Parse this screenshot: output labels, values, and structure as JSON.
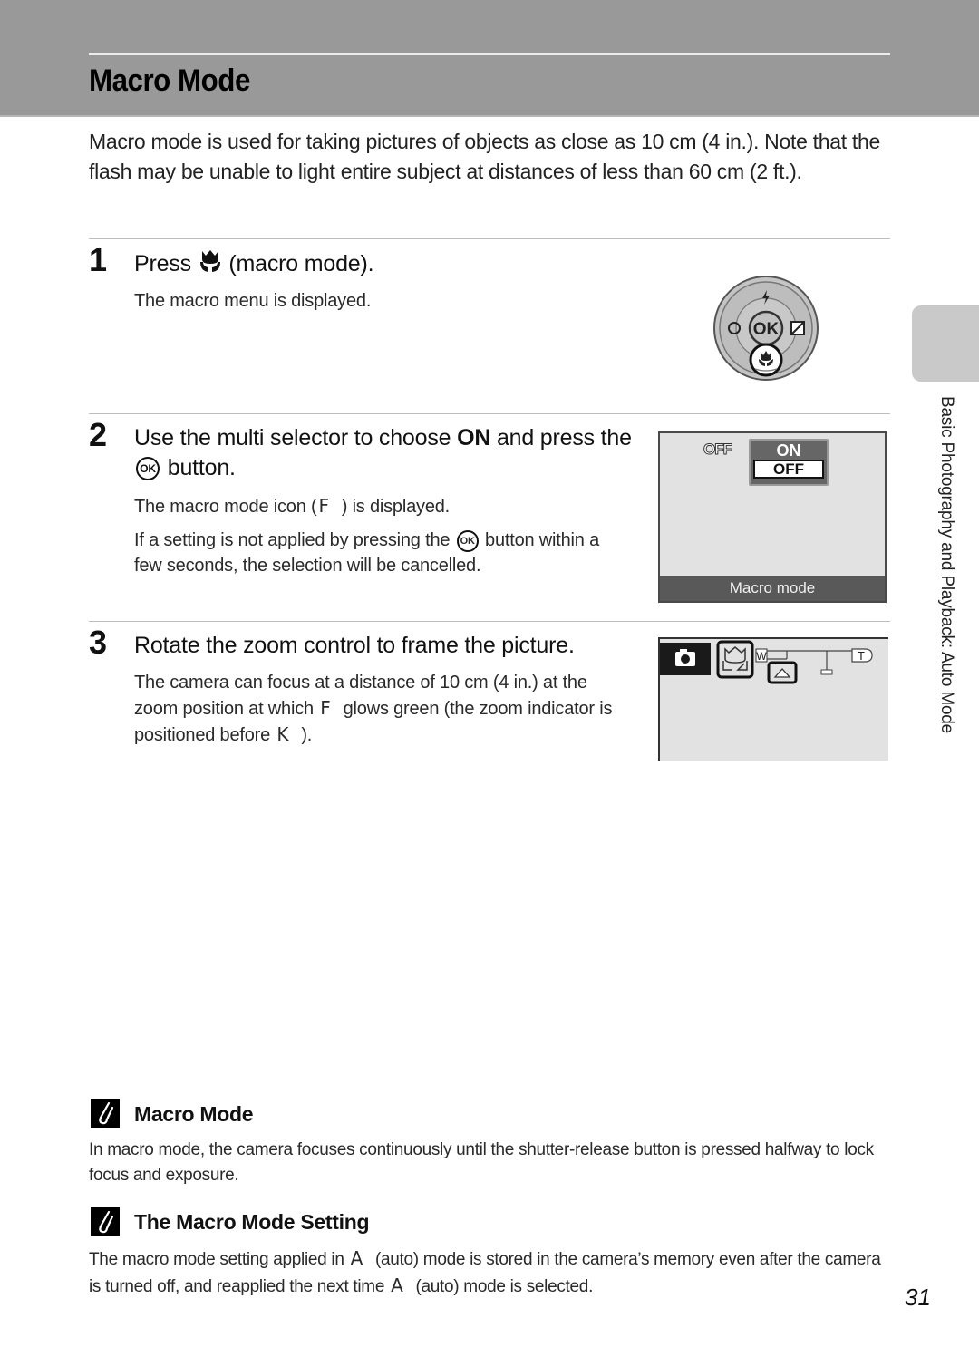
{
  "header": {
    "title": "Macro Mode"
  },
  "intro": "Macro mode is used for taking pictures of objects as close as 10 cm (4 in.). Note that the flash may be unable to light entire subject at distances of less than 60 cm (2 ft.).",
  "steps": [
    {
      "number": "1",
      "heading_pre": "Press",
      "heading_icon": "macro-tulip-icon",
      "heading_post": "(macro mode).",
      "body": [
        "The macro menu is displayed."
      ],
      "illustration": {
        "type": "multi-selector",
        "center_label": "OK",
        "icons": [
          "flash-icon",
          "self-timer-icon",
          "exposure-compensation-icon",
          "macro-tulip-icon"
        ],
        "highlighted": "macro-tulip-icon"
      }
    },
    {
      "number": "2",
      "heading_pre": "Use the multi selector to choose",
      "heading_bold": "ON",
      "heading_mid": "and press the",
      "heading_ok": "OK",
      "heading_post": "button.",
      "body_1_pre": "The macro mode icon (",
      "body_1_glyph": "F",
      "body_1_post": ") is displayed.",
      "body_2_pre": "If a setting is not applied by pressing the",
      "body_2_ok": "OK",
      "body_2_post": "button within a few seconds, the selection will be cancelled.",
      "screen": {
        "current_icon_label": "OFF",
        "menu_options": [
          "ON",
          "OFF"
        ],
        "selected_option": "OFF",
        "caption": "Macro mode"
      }
    },
    {
      "number": "3",
      "heading": "Rotate the zoom control to frame the picture.",
      "body_pre": "The camera can focus at a distance of 10 cm (4 in.) at the zoom position at which",
      "body_glyph_1": "F",
      "body_mid": "glows green (the zoom indicator is positioned before",
      "body_glyph_2": "K",
      "body_post": ").",
      "screen": {
        "zoom_wide_label": "W",
        "zoom_tele_label": "T"
      }
    }
  ],
  "side_tab": {
    "label": "Basic Photography and Playback: Auto Mode"
  },
  "notes": [
    {
      "icon": "pencil-note-icon",
      "title": "Macro Mode",
      "body": "In macro mode, the camera focuses continuously until the shutter-release button is pressed halfway to lock focus and exposure."
    },
    {
      "icon": "pencil-note-icon",
      "title": "The Macro Mode Setting",
      "body_pre": "The macro mode setting applied in",
      "glyph": "A",
      "body_mid": "(auto) mode is stored in the camera’s memory even after the camera is turned off, and reapplied the next time",
      "body_post": "(auto) mode is selected."
    }
  ],
  "page_number": "31"
}
